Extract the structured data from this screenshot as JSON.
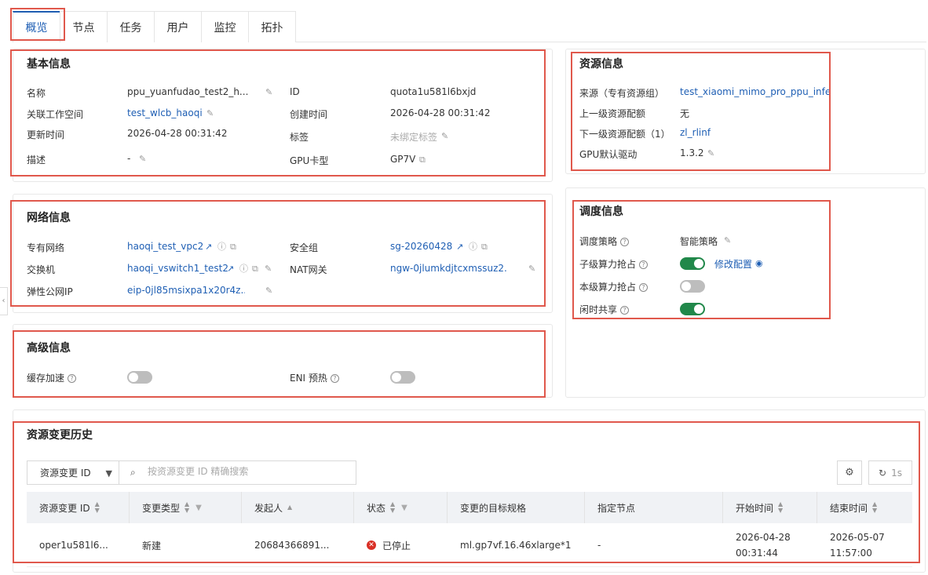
{
  "tabs": [
    {
      "label": "概览"
    },
    {
      "label": "节点"
    },
    {
      "label": "任务"
    },
    {
      "label": "用户"
    },
    {
      "label": "监控"
    },
    {
      "label": "拓扑"
    }
  ],
  "basic": {
    "title": "基本信息",
    "name_label": "名称",
    "name_value": "ppu_yuanfudao_test2_h...",
    "id_label": "ID",
    "id_value": "quota1u581l6bxjd",
    "workspace_label": "关联工作空间",
    "workspace_value": "test_wlcb_haoqi",
    "created_label": "创建时间",
    "created_value": "2026-04-28 00:31:42",
    "updated_label": "更新时间",
    "updated_value": "2026-04-28 00:31:42",
    "tags_label": "标签",
    "tags_value": "未绑定标签",
    "desc_label": "描述",
    "desc_value": "-",
    "gpu_label": "GPU卡型",
    "gpu_value": "GP7V"
  },
  "resource": {
    "title": "资源信息",
    "source_label": "来源（专有资源组）",
    "source_value": "test_xiaomi_mimo_pro_ppu_infer",
    "upper_label": "上一级资源配额",
    "upper_value": "无",
    "lower_label": "下一级资源配额（1）",
    "lower_value": "zl_rlinf",
    "driver_label": "GPU默认驱动",
    "driver_value": "1.3.2"
  },
  "network": {
    "title": "网络信息",
    "vpc_label": "专有网络",
    "vpc_value": "haoqi_test_vpc2",
    "sg_label": "安全组",
    "sg_value": "sg-20260428",
    "vswitch_label": "交换机",
    "vswitch_value": "haoqi_vswitch1_test2",
    "nat_label": "NAT网关",
    "nat_value": "ngw-0jlumkdjtcxmssuz2...",
    "eip_label": "弹性公网IP",
    "eip_value": "eip-0jl85msixpa1x20r4z..."
  },
  "schedule": {
    "title": "调度信息",
    "policy_label": "调度策略",
    "policy_value": "智能策略",
    "child_preempt_label": "子级算力抢占",
    "modify_link": "修改配置",
    "self_preempt_label": "本级算力抢占",
    "idle_share_label": "闲时共享",
    "child_preempt_on": true,
    "self_preempt_on": false,
    "idle_share_on": true
  },
  "advanced": {
    "title": "高级信息",
    "cache_label": "缓存加速",
    "eni_label": "ENI 预热",
    "cache_on": false,
    "eni_on": false
  },
  "history": {
    "title": "资源变更历史",
    "filter_select": "资源变更 ID",
    "search_placeholder": "按资源变更 ID 精确搜索",
    "refresh_label": "1s",
    "columns": [
      "资源变更 ID",
      "变更类型",
      "发起人",
      "状态",
      "变更的目标规格",
      "指定节点",
      "开始时间",
      "结束时间"
    ],
    "rows": [
      {
        "id": "oper1u581l6...",
        "type": "新建",
        "initiator": "20684366891...",
        "status": "已停止",
        "spec": "ml.gp7vf.16.46xlarge*1",
        "node": "-",
        "start_date": "2026-04-28",
        "start_time": "00:31:44",
        "end_date": "2026-05-07",
        "end_time": "11:57:00"
      }
    ]
  },
  "colors": {
    "accent": "#1f5fb4",
    "switch_on": "#21884a",
    "highlight_border": "#e0584c",
    "status_stopped": "#d93026"
  }
}
